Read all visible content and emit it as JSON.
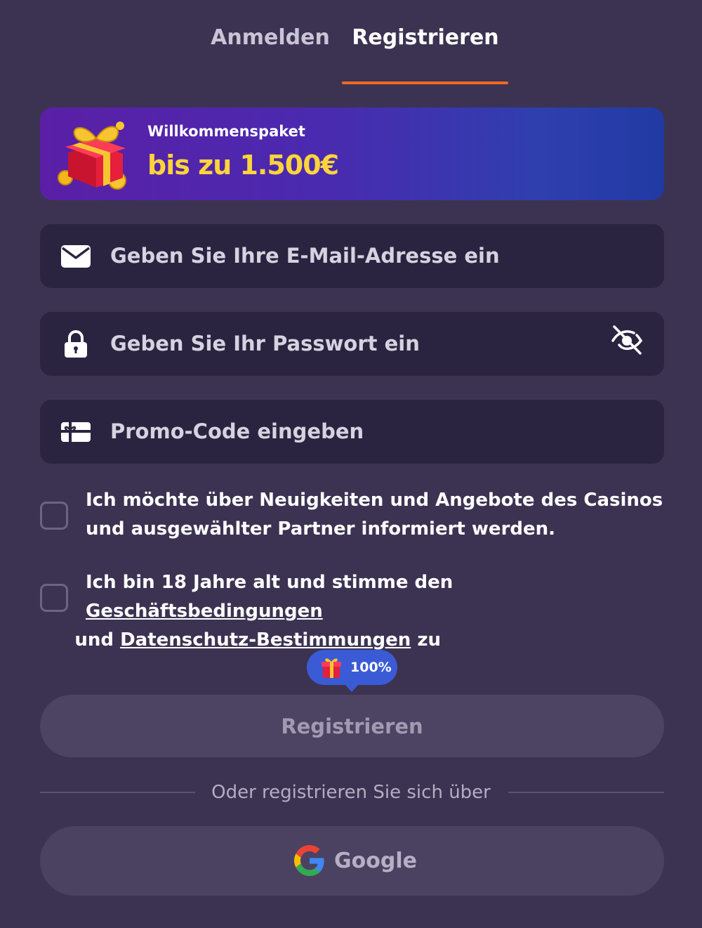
{
  "tabs": {
    "login_label": "Anmelden",
    "register_label": "Registrieren",
    "active": "register",
    "active_color": "#f26a21"
  },
  "banner": {
    "title": "Willkommenspaket",
    "amount": "bis zu 1.500€",
    "icon": "gift-icon"
  },
  "fields": {
    "email": {
      "placeholder": "Geben Sie Ihre E-Mail-Adresse ein",
      "value": "",
      "icon": "envelope-icon"
    },
    "password": {
      "placeholder": "Geben Sie Ihr Passwort ein",
      "value": "",
      "icon": "lock-icon",
      "toggle_icon": "eye-off-icon"
    },
    "promo": {
      "placeholder": "Promo-Code eingeben",
      "value": "",
      "icon": "gift-card-icon"
    }
  },
  "consents": {
    "newsletter": {
      "text": "Ich möchte über Neuigkeiten und Angebote des Casinos und ausgewählter Partner informiert werden.",
      "checked": false
    },
    "terms": {
      "text_before": "Ich bin 18 Jahre alt und stimme den ",
      "terms_link": "Geschäftsbedingungen",
      "text_middle": " und ",
      "privacy_link": "Datenschutz-Bestimmungen",
      "text_after": " zu",
      "checked": false
    }
  },
  "bonus_badge": {
    "label": "100%",
    "color": "#3b5bd6"
  },
  "register_button": {
    "label": "Registrieren"
  },
  "divider": {
    "label": "Oder registrieren Sie sich über"
  },
  "google_button": {
    "label": "Google",
    "icon": "google-icon"
  },
  "colors": {
    "background": "#3c3352",
    "field_background": "#2b2440",
    "banner_amount": "#ffd43b"
  }
}
